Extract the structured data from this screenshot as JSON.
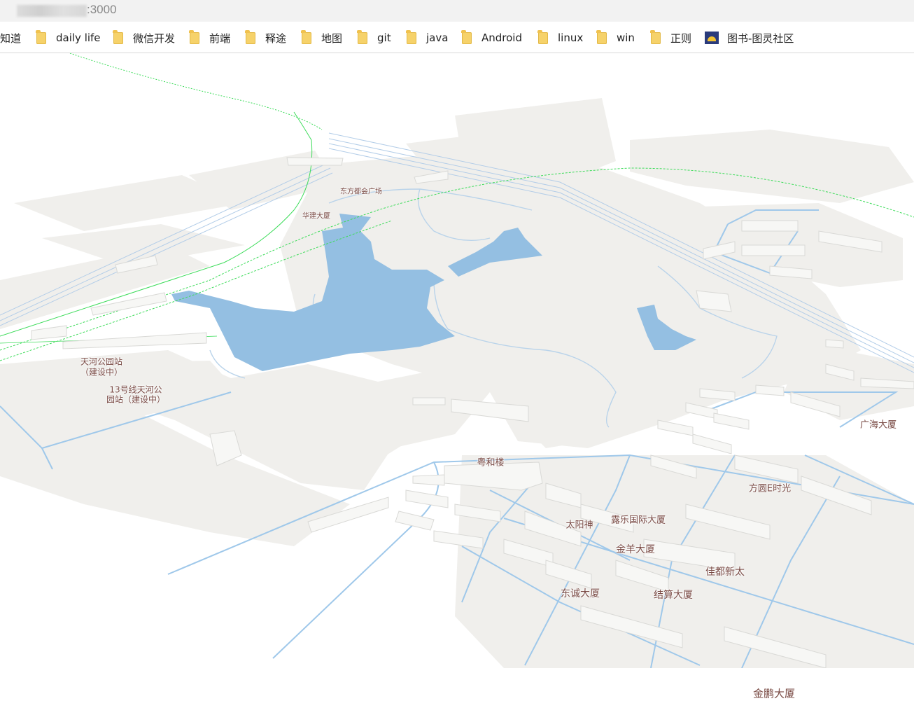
{
  "address_bar": {
    "url_visible": ":3000"
  },
  "bookmarks": [
    {
      "label": "知道",
      "icon": "folder-icon"
    },
    {
      "label": "daily life",
      "icon": "folder-icon"
    },
    {
      "label": "微信开发",
      "icon": "folder-icon"
    },
    {
      "label": "前端",
      "icon": "folder-icon"
    },
    {
      "label": "释途",
      "icon": "folder-icon"
    },
    {
      "label": "地图",
      "icon": "folder-icon"
    },
    {
      "label": "git",
      "icon": "folder-icon"
    },
    {
      "label": "java",
      "icon": "folder-icon"
    },
    {
      "label": "Android",
      "icon": "folder-icon"
    },
    {
      "label": "linux",
      "icon": "folder-icon"
    },
    {
      "label": "win",
      "icon": "folder-icon"
    },
    {
      "label": "正则",
      "icon": "folder-icon"
    },
    {
      "label": "图书-图灵社区",
      "icon": "turing-favicon-icon"
    }
  ],
  "map": {
    "colors": {
      "land": "#f0efec",
      "water": "#94bfe2",
      "building": "#f7f7f5",
      "road": "#9fc8ea",
      "metro": "#3ddc5a"
    },
    "labels": {
      "dongfang": "东方都会广场",
      "huajian": "华建大厦",
      "tianhe_station": "天河公园站",
      "under_construction": "（建设中）",
      "line13_a": "13号线天河公",
      "line13_b": "园站（建设中）",
      "yuehe": "粤和楼",
      "guanghai": "广海大厦",
      "fangyuan": "方圆E时光",
      "taiyangshen": "太阳神",
      "lule": "露乐国际大厦",
      "jinyang": "金羊大厦",
      "jiadu": "佳都新太",
      "dongcheng": "东诚大厦",
      "jiesuan": "结算大厦",
      "jinpeng": "金鹏大厦"
    }
  }
}
